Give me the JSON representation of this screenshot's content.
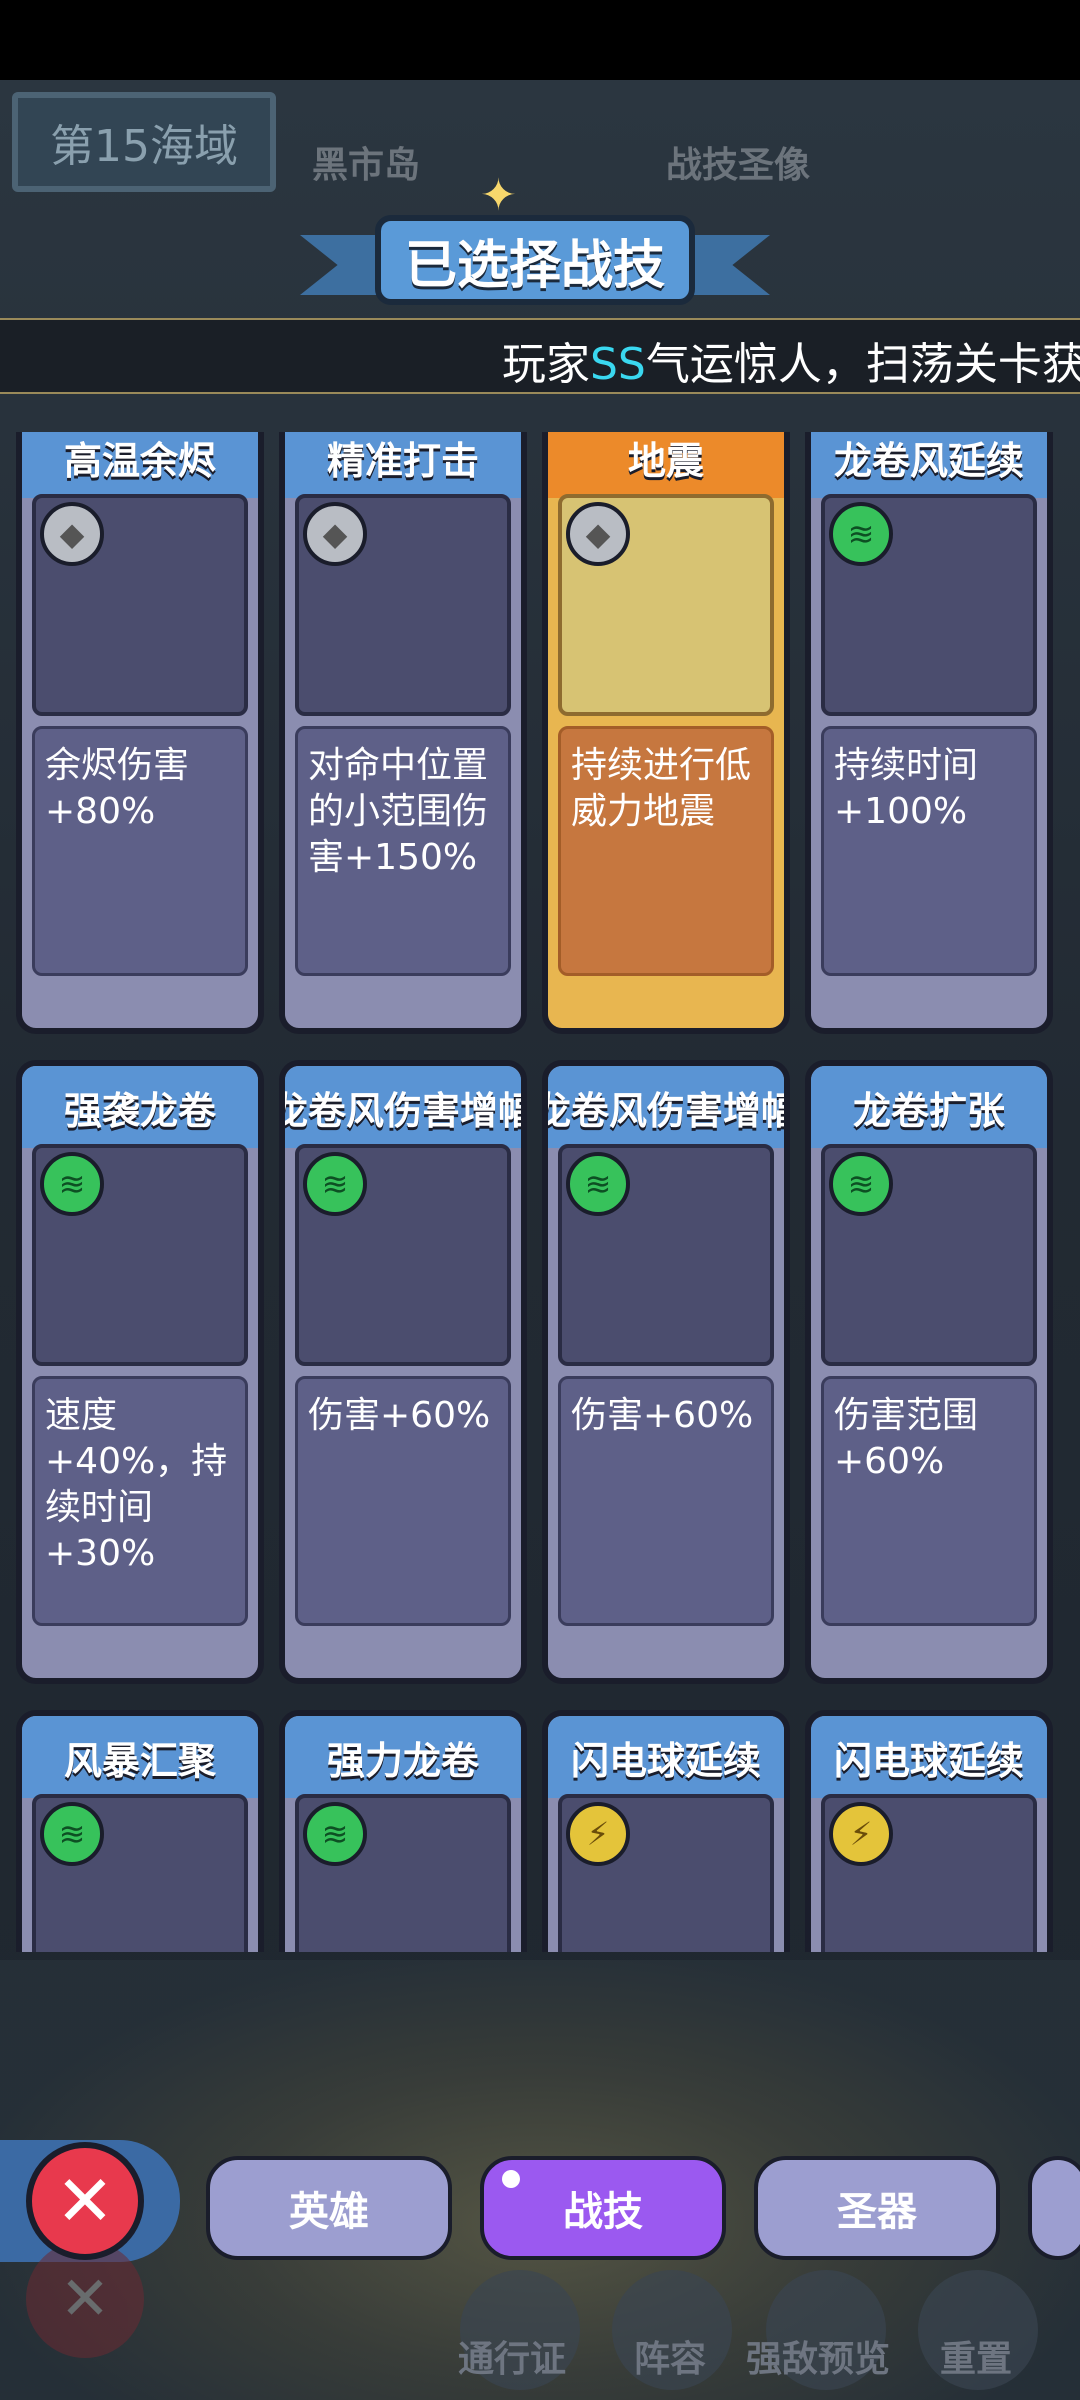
{
  "map": {
    "sea_label": "第15海域",
    "island_labels": [
      "黑市岛",
      "战技圣像"
    ]
  },
  "header": {
    "title": "已选择战技"
  },
  "marquee": {
    "prefix": "玩家",
    "highlight": "SS",
    "suffix": "气运惊人，扫荡关卡获"
  },
  "colors": {
    "card_title_blue": "#5a94d4",
    "card_selected": "#e8b650",
    "tab_active": "#9b59f0",
    "tab_inactive": "#9c9ed0",
    "close_red": "#e8394d"
  },
  "skills": [
    {
      "title": "高温余烬",
      "desc": "余烬伤害+80%",
      "element": "rock-icon",
      "selected": false
    },
    {
      "title": "精准打击",
      "desc": "对命中位置的小范围伤害+150%",
      "element": "rock-icon",
      "selected": false
    },
    {
      "title": "地震",
      "desc": "持续进行低威力地震",
      "element": "rock-icon",
      "selected": true
    },
    {
      "title": "龙卷风延续",
      "desc": "持续时间+100%",
      "element": "wind-icon",
      "selected": false
    },
    {
      "title": "强袭龙卷",
      "desc": "速度+40%，持续时间+30%",
      "element": "wind-icon",
      "selected": false
    },
    {
      "title": "龙卷风伤害增幅",
      "desc": "伤害+60%",
      "element": "wind-icon",
      "selected": false
    },
    {
      "title": "龙卷风伤害增幅",
      "desc": "伤害+60%",
      "element": "wind-icon",
      "selected": false
    },
    {
      "title": "龙卷扩张",
      "desc": "伤害范围+60%",
      "element": "wind-icon",
      "selected": false
    },
    {
      "title": "风暴汇聚",
      "desc": "",
      "element": "wind-icon",
      "selected": false
    },
    {
      "title": "强力龙卷",
      "desc": "",
      "element": "wind-icon",
      "selected": false
    },
    {
      "title": "闪电球延续",
      "desc": "",
      "element": "thunder-icon",
      "selected": false
    },
    {
      "title": "闪电球延续",
      "desc": "",
      "element": "thunder-icon",
      "selected": false
    }
  ],
  "tabs": [
    {
      "label": "英雄",
      "active": false
    },
    {
      "label": "战技",
      "active": true
    },
    {
      "label": "圣器",
      "active": false
    }
  ],
  "bottom_nav": [
    "通行证",
    "阵容",
    "强敌预览",
    "重置"
  ]
}
